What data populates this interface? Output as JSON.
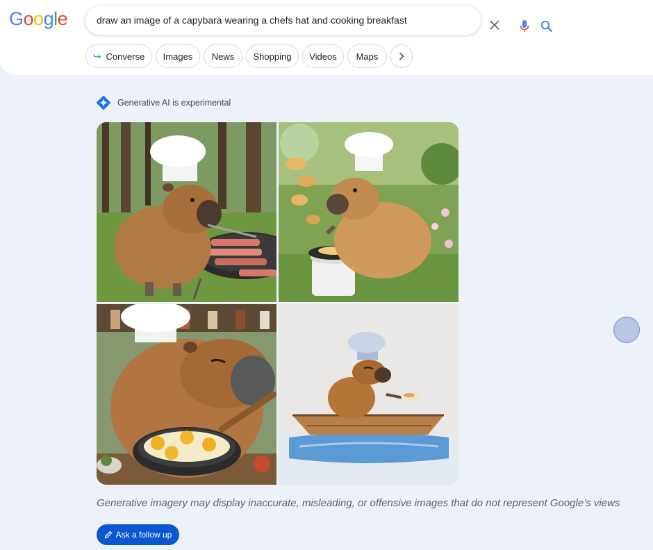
{
  "header": {
    "logo": "Google",
    "search_query": "draw an image of a capybara wearing a chefs hat and cooking breakfast"
  },
  "chips": [
    {
      "label": "Converse",
      "icon": "converse-arrow-icon"
    },
    {
      "label": "Images"
    },
    {
      "label": "News"
    },
    {
      "label": "Shopping"
    },
    {
      "label": "Videos"
    },
    {
      "label": "Maps"
    }
  ],
  "ai": {
    "badge_label": "Generative AI is experimental",
    "images": [
      {
        "icon": "capybara-grilling-bacon-forest-image"
      },
      {
        "icon": "capybara-flipping-pancakes-garden-image"
      },
      {
        "icon": "capybara-frying-eggs-kitchen-image"
      },
      {
        "icon": "capybara-cooking-in-boat-image"
      }
    ],
    "disclaimer": "Generative imagery may display inaccurate, misleading, or offensive images that do not represent Google’s views",
    "followup_label": "Ask a follow up"
  },
  "colors": {
    "page_bg": "#edf1f8",
    "accent_blue": "#0b57d0",
    "google_blue": "#4285f4",
    "google_red": "#ea4335",
    "google_yellow": "#fbbc05",
    "google_green": "#34a853"
  }
}
